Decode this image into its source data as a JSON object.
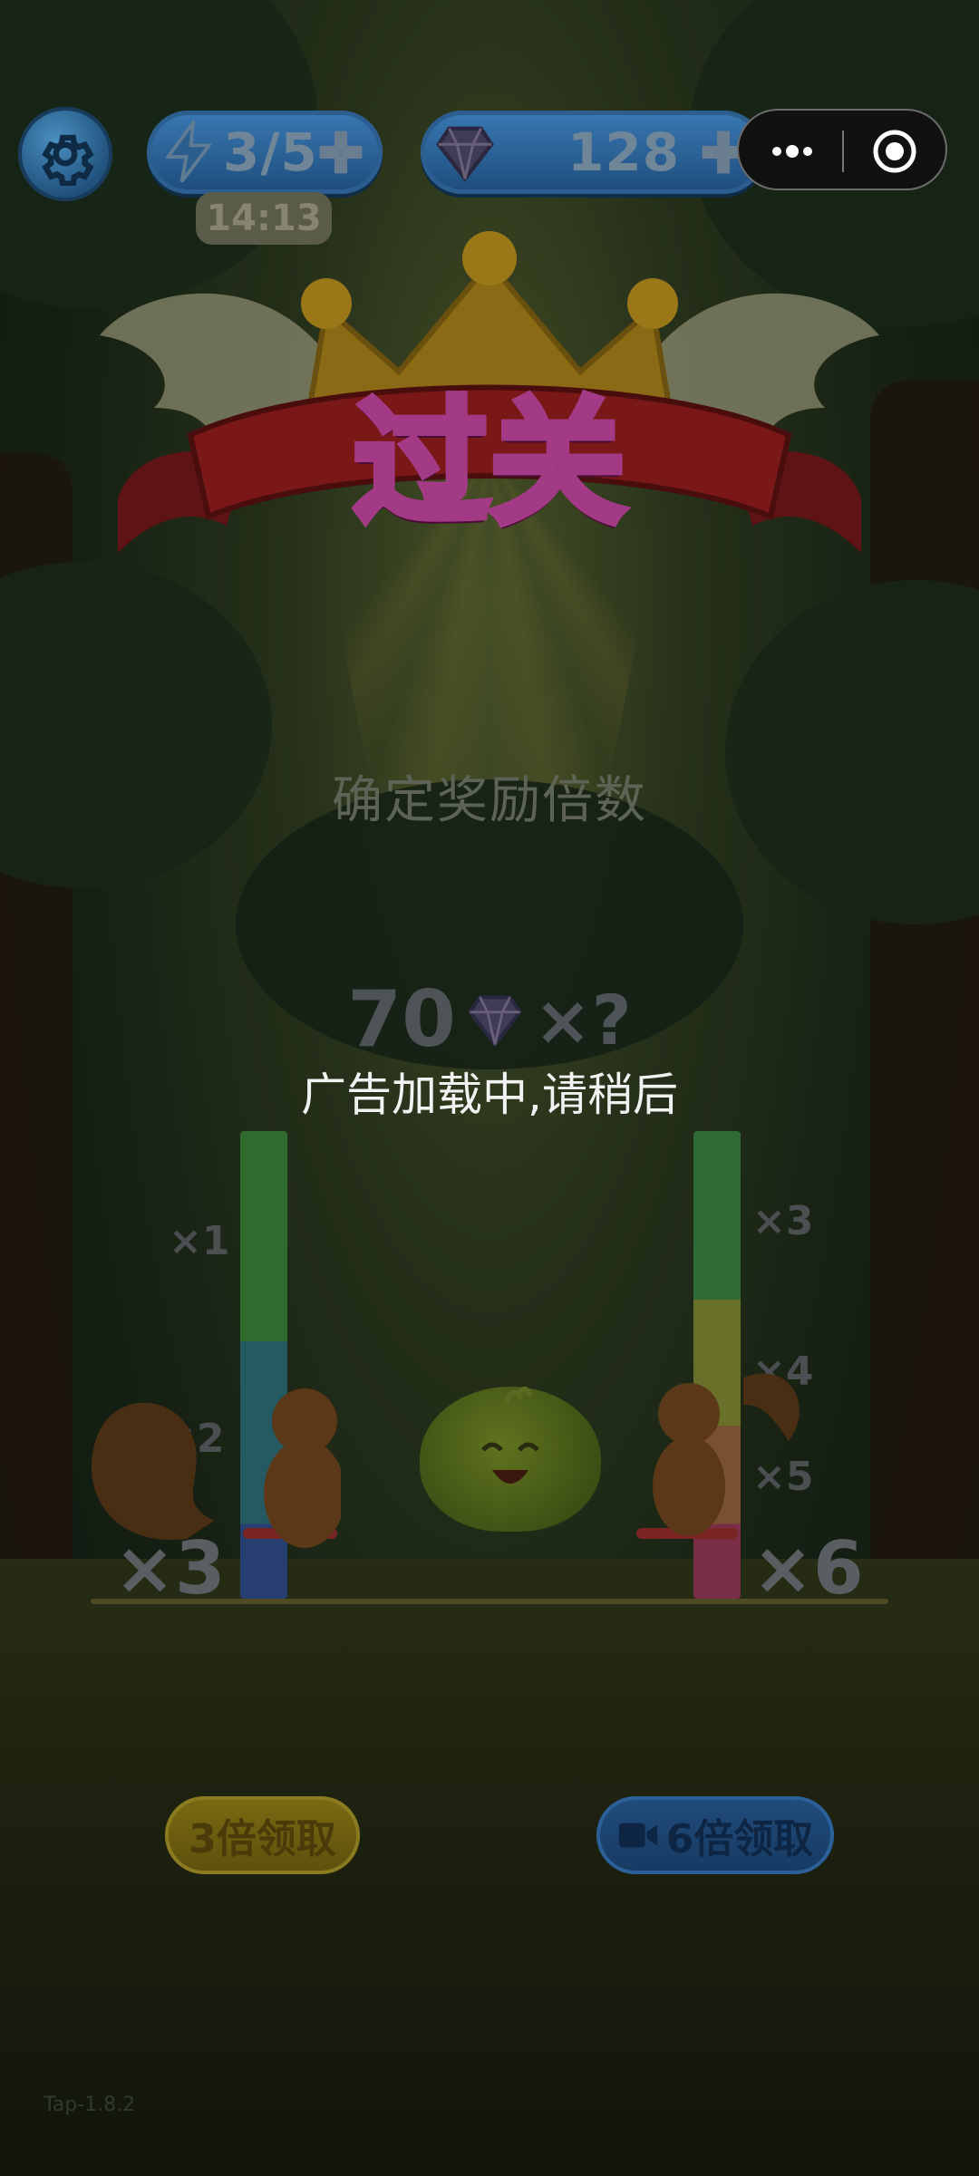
{
  "header": {
    "energy": "3/5",
    "timer": "14:13",
    "gems": "128"
  },
  "banner": {
    "title": "过关"
  },
  "reward": {
    "subtitle": "确定奖励倍数",
    "base_amount": "70",
    "multiplier_text": "×?",
    "loading_message": "广告加载中,请稍后"
  },
  "left_meter": {
    "labels": [
      "×1",
      "×2"
    ],
    "result": "×3"
  },
  "right_meter": {
    "labels": [
      "×3",
      "×4",
      "×5"
    ],
    "result": "×6"
  },
  "buttons": {
    "claim_3x": "3倍领取",
    "claim_6x": "6倍领取"
  },
  "footer": {
    "version": "Tap-1.8.2"
  },
  "icons": {
    "settings": "gear-icon",
    "energy": "lightning-icon",
    "gem": "gem-icon",
    "more": "more-dots-icon",
    "close": "target-circle-icon",
    "video": "video-camera-icon"
  }
}
